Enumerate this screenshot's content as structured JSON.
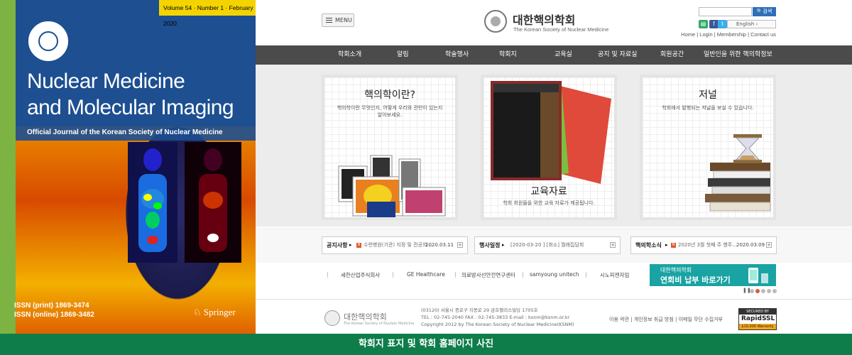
{
  "cover": {
    "volume": "Volume 54 · Number 1 · February 2020",
    "title_line1": "Nuclear Medicine",
    "title_line2": "and Molecular Imaging",
    "subtitle": "Official Journal of the Korean Society of Nuclear Medicine",
    "issn_print": "ISSN (print) 1869-3474",
    "issn_online": "ISSN (online) 1869-3482",
    "publisher": "Springer"
  },
  "header": {
    "menu_label": "MENU",
    "logo_ko": "대한핵의학회",
    "logo_en": "The Korean Society of Nuclear Medicine",
    "search_button": "검색",
    "language": "English",
    "top_links": "Home | Login | Membership | Contact us",
    "sns": [
      "f",
      "t"
    ]
  },
  "gnb": [
    "학회소개",
    "알림",
    "학술행사",
    "학회지",
    "교육실",
    "공지 및 자료실",
    "회원공간",
    "일반인을 위한 핵의학정보"
  ],
  "cards": [
    {
      "title": "핵의학이란?",
      "desc": "핵의학이란 무엇인지, 어떻게 우리와 관련이 있는지 알아보세요."
    },
    {
      "title": "교육자료",
      "desc": "학회 회원들을 위한 교육 자료가 제공됩니다."
    },
    {
      "title": "저널",
      "desc": "학회에서 발행되는 저널을 보실 수 있습니다."
    }
  ],
  "notices": [
    {
      "label": "공지사항",
      "text": "수련병원(기관) 지정 및 전공의...",
      "date": "2020.03.11"
    },
    {
      "label": "행사일정",
      "text": "[2020-03-20 ] [취소] 월례집담회",
      "date": ""
    },
    {
      "label": "핵의학소식",
      "text": "2020년 3월 첫째 주 핸주...",
      "date": "2020.03.09"
    }
  ],
  "partners": [
    "세한산업주식회사",
    "GE Healthcare",
    "의료방사선안전연구센터",
    "samyoung unitech",
    "시노피젠자임"
  ],
  "banner": {
    "small": "대한핵의학회",
    "large": "연회비 납부 바로가기"
  },
  "footer": {
    "logo_ko": "대한핵의학회",
    "logo_en": "The Korean Society of Nuclear Medicine",
    "addr1": "(03120) 서울시 종로구 지봉로 29 금호팰리스빌딩 1705호",
    "addr2": "TEL : 02-745-2040 FAX : 02-745-3833 E-mail : ksnm@ksnm.or.kr",
    "addr3": "Copyright 2012 by The Korean Society of Nuclear Medicine(KSNM)",
    "links": "이용 약관  |  개인정보 취급 방침  |  이메일 무단 수집거부",
    "ssl_top": "SECURED BY",
    "ssl_mid": "RapidSSL",
    "ssl_bot": "$10,000 Warranty"
  },
  "caption": "학회지 표지 및 학회 홈페이지 사진",
  "colors": {
    "gnb": "#4b4b4b",
    "caption": "#0e7d4a",
    "cover_blue": "#1d4f91",
    "banner": "#1aa3a3"
  }
}
